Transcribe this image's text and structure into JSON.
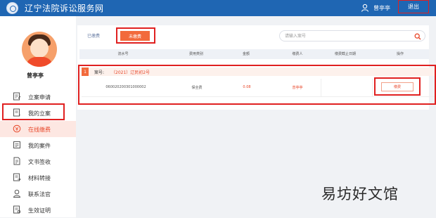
{
  "header": {
    "site_title": "辽宁法院诉讼服务网",
    "user_name": "曾亭亭",
    "logout_label": "退出"
  },
  "sidebar": {
    "user_name": "曾亭亭",
    "items": [
      {
        "label": "立案申请",
        "icon": "filing-icon"
      },
      {
        "label": "我的立案",
        "icon": "my-filing-icon"
      },
      {
        "label": "在线缴费",
        "icon": "payment-icon",
        "active": true
      },
      {
        "label": "我的案件",
        "icon": "my-case-icon"
      },
      {
        "label": "文书签收",
        "icon": "document-icon"
      },
      {
        "label": "材料转接",
        "icon": "material-icon"
      },
      {
        "label": "联系法官",
        "icon": "judge-icon"
      },
      {
        "label": "生效证明",
        "icon": "certificate-icon"
      }
    ]
  },
  "main": {
    "tabs": [
      {
        "label": "已缴费"
      },
      {
        "label": "未缴费",
        "active": true
      }
    ],
    "search": {
      "placeholder": "请输入案号"
    },
    "columns": [
      "流水号",
      "费用类别",
      "金额",
      "缴费人",
      "缴费截止日期",
      "操作"
    ],
    "case": {
      "index": "1",
      "case_label": "案号:",
      "case_number": "（2021）辽民初2号",
      "rows": [
        {
          "serial": "060020200301000002",
          "fee_type": "保全费",
          "amount": "0.08",
          "payer": "曾亭亭",
          "deadline": "",
          "action": "缴费"
        }
      ]
    }
  },
  "watermark": "易坊好文馆",
  "colors": {
    "header": "#1f66b3",
    "accent": "#f26a3c",
    "highlight": "#e02020"
  }
}
